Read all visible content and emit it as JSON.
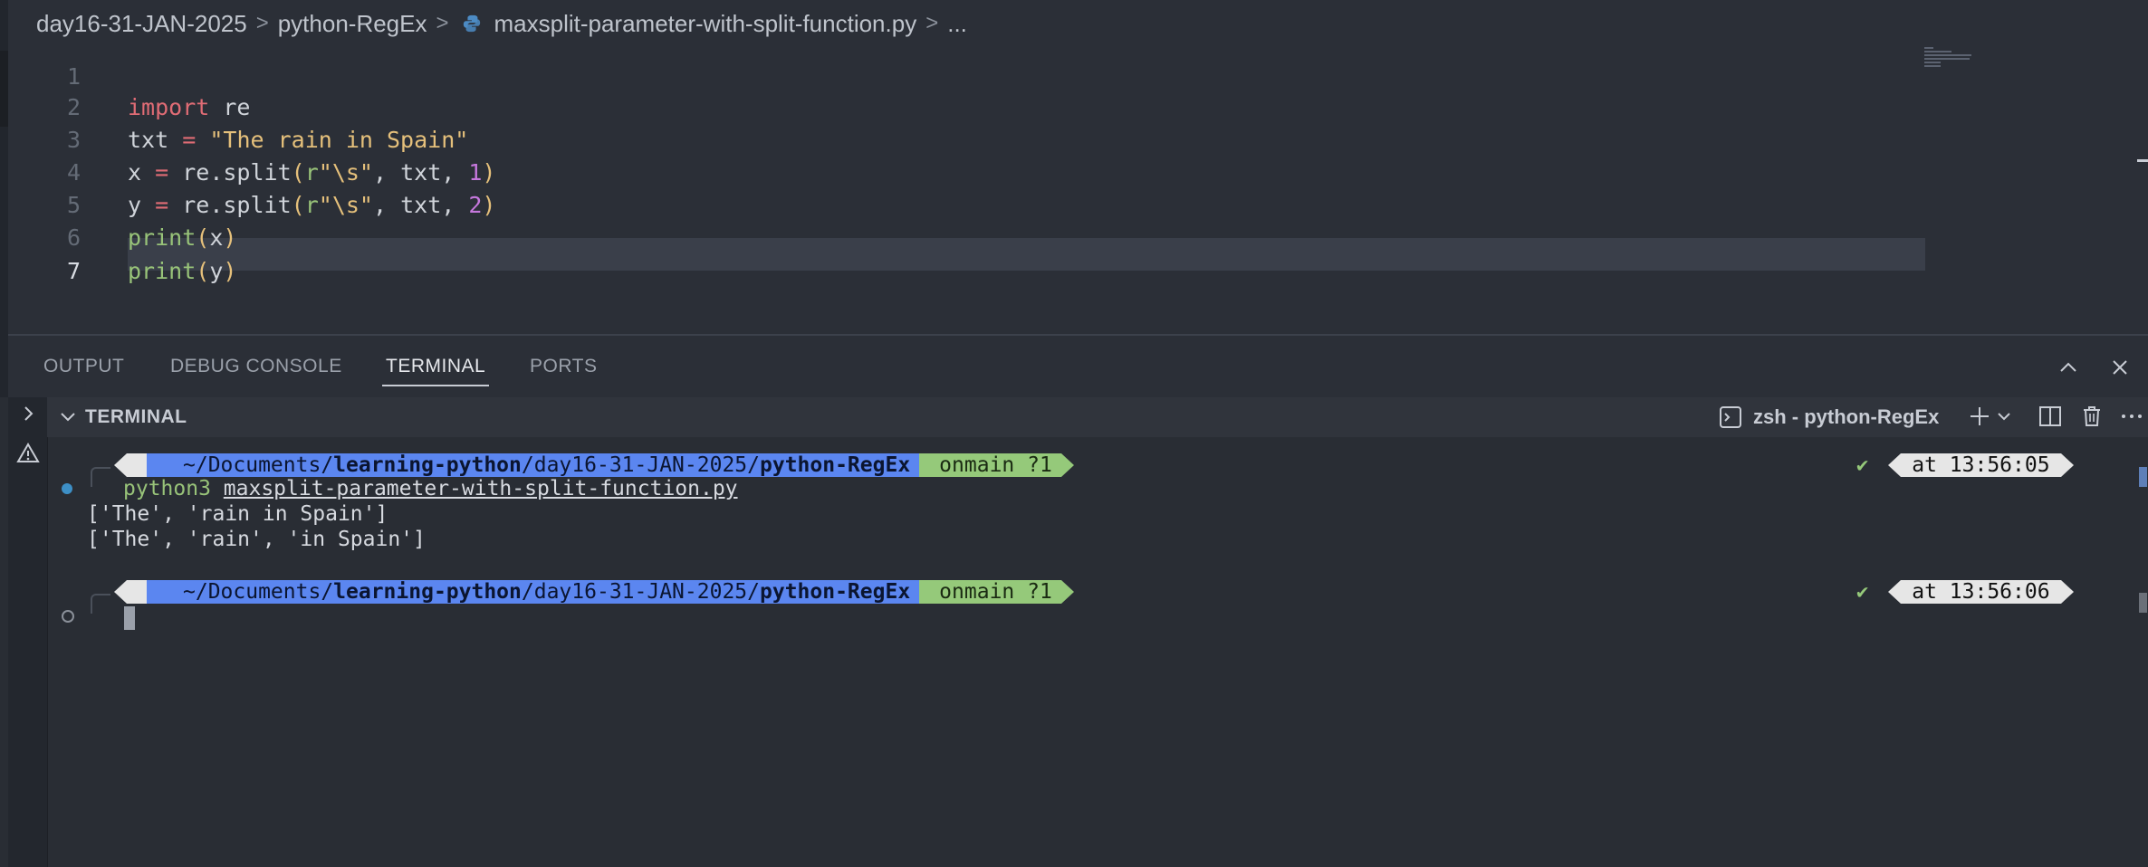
{
  "breadcrumb": {
    "items": [
      "day16-31-JAN-2025",
      "python-RegEx",
      "maxsplit-parameter-with-split-function.py",
      "..."
    ],
    "separator": ">"
  },
  "editor": {
    "line_numbers": [
      "1",
      "2",
      "3",
      "4",
      "5",
      "6",
      "7"
    ],
    "current_line": "7",
    "lines": {
      "l2": {
        "kw": "import",
        "rest": " re"
      },
      "l3": {
        "a": "txt ",
        "op": "=",
        "b": " ",
        "str": "\"The rain in Spain\""
      },
      "l4": {
        "a": "x ",
        "op": "=",
        "b": " re.split",
        "p1": "(",
        "r": "r",
        "str": "\"\\s\"",
        "c": ", txt, ",
        "num": "1",
        "p2": ")"
      },
      "l5": {
        "a": "y ",
        "op": "=",
        "b": " re.split",
        "p1": "(",
        "r": "r",
        "str": "\"\\s\"",
        "c": ", txt, ",
        "num": "2",
        "p2": ")"
      },
      "l6": {
        "fn": "print",
        "p1": "(",
        "arg": "x",
        "p2": ")"
      },
      "l7": {
        "fn": "print",
        "p1": "(",
        "arg": "y",
        "p2": ")"
      }
    }
  },
  "panel": {
    "tabs": [
      "OUTPUT",
      "DEBUG CONSOLE",
      "TERMINAL",
      "PORTS"
    ],
    "active_tab": "TERMINAL"
  },
  "terminal": {
    "section_title": "TERMINAL",
    "instance_name": "zsh - python-RegEx",
    "prompts": [
      {
        "os_icon": "",
        "folder_icon": "",
        "path_prefix": "~/Documents/",
        "path_repo": "learning-python",
        "path_mid": "/day16-31-JAN-2025/",
        "path_dir": "python-RegEx",
        "git_on": "on ",
        "git_icons": " ",
        "git_branch": " main ?1",
        "check": "✔",
        "time": "at 13:56:05 "
      },
      {
        "os_icon": "",
        "folder_icon": "",
        "path_prefix": "~/Documents/",
        "path_repo": "learning-python",
        "path_mid": "/day16-31-JAN-2025/",
        "path_dir": "python-RegEx",
        "git_on": "on ",
        "git_icons": " ",
        "git_branch": " main ?1",
        "check": "✔",
        "time": "at 13:56:06 "
      }
    ],
    "command": {
      "prog": "python3",
      "file": "maxsplit-parameter-with-split-function.py"
    },
    "output": [
      "['The', 'rain in Spain']",
      "['The', 'rain', 'in Spain']"
    ]
  },
  "colors": {
    "path_segment": "#5b86f0",
    "git_segment": "#95c97a",
    "os_segment": "#e6e6e6",
    "status_dot_done": "#3d8fc6"
  }
}
